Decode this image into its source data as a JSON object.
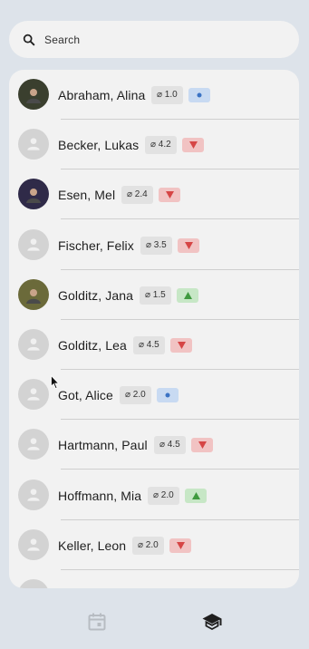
{
  "search": {
    "placeholder": "Search"
  },
  "students": [
    {
      "name": "Abraham, Alina",
      "average": "⌀ 1.0",
      "trend": "same",
      "photo": true
    },
    {
      "name": "Becker, Lukas",
      "average": "⌀ 4.2",
      "trend": "down",
      "photo": false
    },
    {
      "name": "Esen, Mel",
      "average": "⌀ 2.4",
      "trend": "down",
      "photo": true
    },
    {
      "name": "Fischer, Felix",
      "average": "⌀ 3.5",
      "trend": "down",
      "photo": false
    },
    {
      "name": "Golditz, Jana",
      "average": "⌀ 1.5",
      "trend": "up",
      "photo": true
    },
    {
      "name": "Golditz, Lea",
      "average": "⌀ 4.5",
      "trend": "down",
      "photo": false
    },
    {
      "name": "Got, Alice",
      "average": "⌀ 2.0",
      "trend": "same",
      "photo": false
    },
    {
      "name": "Hartmann, Paul",
      "average": "⌀ 4.5",
      "trend": "down",
      "photo": false
    },
    {
      "name": "Hoffmann, Mia",
      "average": "⌀ 2.0",
      "trend": "up",
      "photo": false
    },
    {
      "name": "Keller, Leon",
      "average": "⌀ 2.0",
      "trend": "down",
      "photo": false
    }
  ],
  "nav": {
    "items": [
      {
        "icon": "calendar-icon",
        "active": false
      },
      {
        "icon": "school-icon",
        "active": true
      }
    ]
  },
  "colors": {
    "down": "#d64545",
    "up": "#3f9a3f",
    "same": "#3b73c4"
  }
}
